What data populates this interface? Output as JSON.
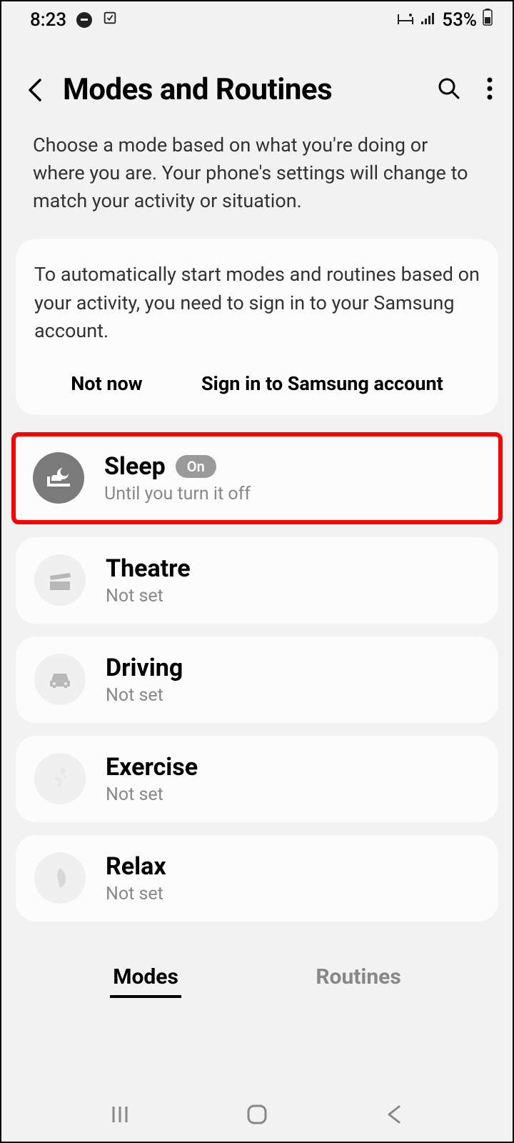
{
  "statusBar": {
    "time": "8:23",
    "battery": "53%"
  },
  "header": {
    "title": "Modes and Routines"
  },
  "description": "Choose a mode based on what you're doing or where you are. Your phone's settings will change to match your activity or situation.",
  "signinCard": {
    "text": "To automatically start modes and routines based on your activity, you need to sign in to your Samsung account.",
    "notNow": "Not now",
    "signIn": "Sign in to Samsung account"
  },
  "modes": [
    {
      "title": "Sleep",
      "subtitle": "Until you turn it off",
      "badge": "On",
      "active": true
    },
    {
      "title": "Theatre",
      "subtitle": "Not set",
      "badge": null,
      "active": false
    },
    {
      "title": "Driving",
      "subtitle": "Not set",
      "badge": null,
      "active": false
    },
    {
      "title": "Exercise",
      "subtitle": "Not set",
      "badge": null,
      "active": false
    },
    {
      "title": "Relax",
      "subtitle": "Not set",
      "badge": null,
      "active": false
    }
  ],
  "tabs": {
    "modes": "Modes",
    "routines": "Routines"
  }
}
